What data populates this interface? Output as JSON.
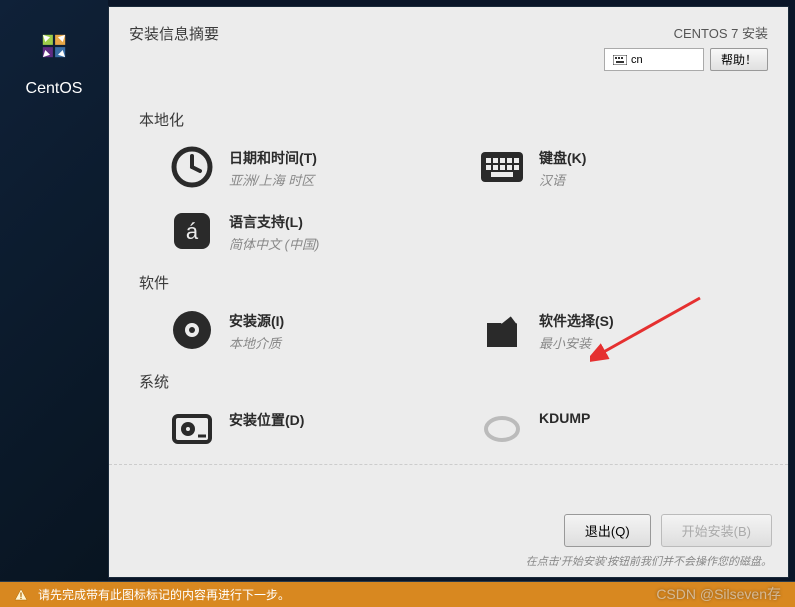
{
  "brand": "CentOS",
  "header": {
    "title": "安装信息摘要",
    "product": "CENTOS 7 安装",
    "lang_code": "cn",
    "help_label": "帮助！"
  },
  "sections": {
    "localization": {
      "header": "本地化",
      "datetime": {
        "title": "日期和时间(T)",
        "status": "亚洲/上海 时区"
      },
      "keyboard": {
        "title": "键盘(K)",
        "status": "汉语"
      },
      "language": {
        "title": "语言支持(L)",
        "status": "简体中文 (中国)"
      }
    },
    "software": {
      "header": "软件",
      "source": {
        "title": "安装源(I)",
        "status": "本地介质"
      },
      "selection": {
        "title": "软件选择(S)",
        "status": "最小安装"
      }
    },
    "system": {
      "header": "系统",
      "destination": {
        "title": "安装位置(D)",
        "status": ""
      },
      "kdump": {
        "title": "KDUMP",
        "status": ""
      }
    }
  },
  "footer": {
    "quit": "退出(Q)",
    "begin": "开始安装(B)",
    "note": "在点击'开始安装'按钮前我们并不会操作您的磁盘。"
  },
  "warning": "请先完成带有此图标标记的内容再进行下一步。",
  "watermark": "CSDN @Silseven存"
}
